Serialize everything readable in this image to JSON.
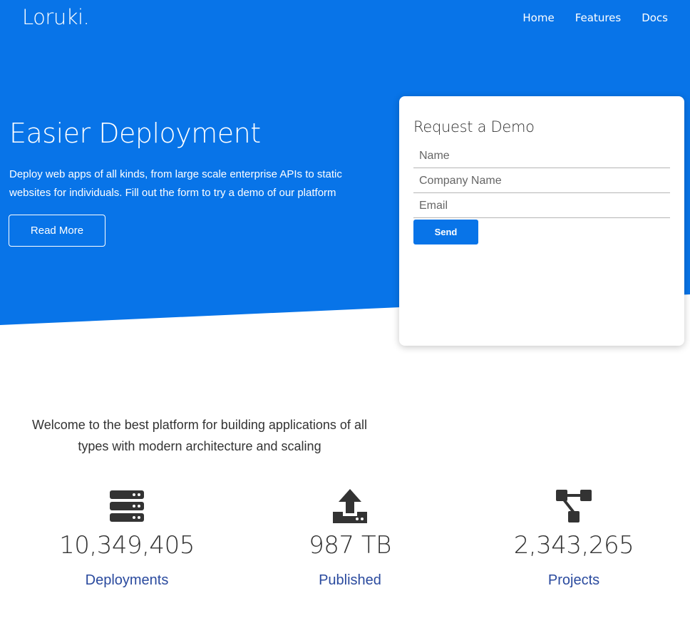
{
  "colors": {
    "primary": "#0874e8",
    "text_dark": "#333333",
    "label_blue": "#2a4a9e",
    "white": "#ffffff"
  },
  "navbar": {
    "brand": "Loruki.",
    "links": [
      "Home",
      "Features",
      "Docs"
    ]
  },
  "hero": {
    "title": "Easier Deployment",
    "description": "Deploy web apps of all kinds, from large scale enterprise APIs to static websites for individuals. Fill out the form to try a demo of our platform",
    "button": "Read More"
  },
  "demo_form": {
    "title": "Request a Demo",
    "fields": [
      {
        "placeholder": "Name",
        "value": ""
      },
      {
        "placeholder": "Company Name",
        "value": ""
      },
      {
        "placeholder": "Email",
        "value": ""
      }
    ],
    "submit": "Send"
  },
  "welcome": {
    "text": "Welcome to the best platform for building applications of all types with modern architecture and scaling"
  },
  "stats": [
    {
      "icon": "server-icon",
      "value": "10,349,405",
      "label": "Deployments"
    },
    {
      "icon": "upload-icon",
      "value": "987 TB",
      "label": "Published"
    },
    {
      "icon": "project-diagram-icon",
      "value": "2,343,265",
      "label": "Projects"
    }
  ]
}
